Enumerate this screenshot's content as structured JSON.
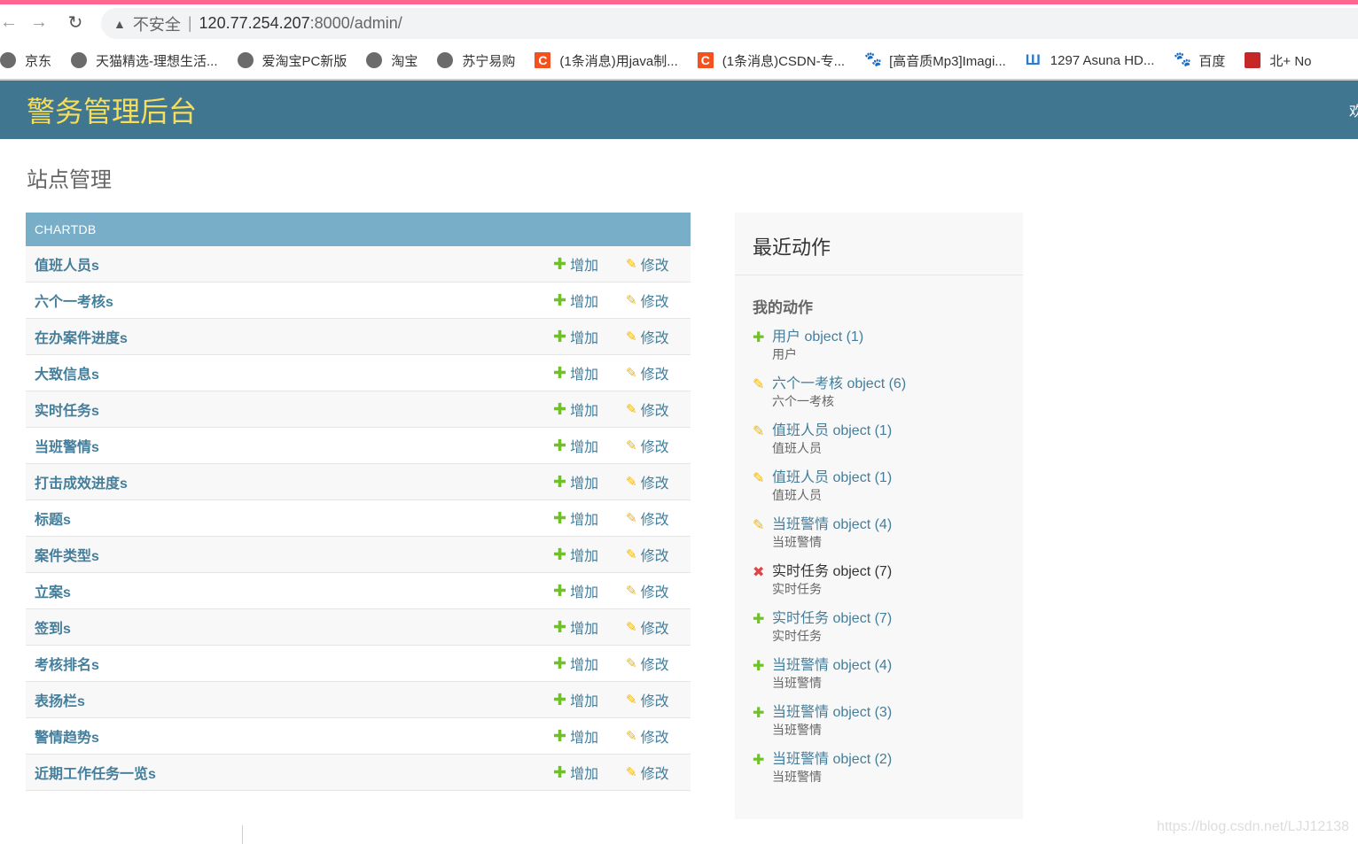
{
  "browser": {
    "url_host": "120.77.254.207",
    "url_rest": ":8000/admin/",
    "insecure_label": "不安全",
    "bookmarks": [
      {
        "label": "京东",
        "icon": "globe"
      },
      {
        "label": "天猫精选-理想生活...",
        "icon": "globe"
      },
      {
        "label": "爱淘宝PC新版",
        "icon": "globe"
      },
      {
        "label": "淘宝",
        "icon": "globe"
      },
      {
        "label": "苏宁易购",
        "icon": "globe"
      },
      {
        "label": "(1条消息)用java制...",
        "icon": "csdn"
      },
      {
        "label": "(1条消息)CSDN-专...",
        "icon": "csdn"
      },
      {
        "label": "[高音质Mp3]Imagi...",
        "icon": "baidu"
      },
      {
        "label": "1297 Asuna HD...",
        "icon": "u"
      },
      {
        "label": "百度",
        "icon": "baidu"
      },
      {
        "label": "北+ No",
        "icon": "seal"
      }
    ]
  },
  "header": {
    "title": "警务管理后台",
    "welcome": "欢"
  },
  "page_title": "站点管理",
  "module": {
    "caption": "CHARTDB",
    "add_label": "增加",
    "change_label": "修改",
    "models": [
      "值班人员s",
      "六个一考核s",
      "在办案件进度s",
      "大致信息s",
      "实时任务s",
      "当班警情s",
      "打击成效进度s",
      "标题s",
      "案件类型s",
      "立案s",
      "签到s",
      "考核排名s",
      "表扬栏s",
      "警情趋势s",
      "近期工作任务一览s"
    ]
  },
  "recent": {
    "title": "最近动作",
    "subtitle": "我的动作",
    "actions": [
      {
        "kind": "add",
        "label": "用户 object (1)",
        "type": "用户"
      },
      {
        "kind": "change",
        "label": "六个一考核 object (6)",
        "type": "六个一考核"
      },
      {
        "kind": "change",
        "label": "值班人员 object (1)",
        "type": "值班人员"
      },
      {
        "kind": "change",
        "label": "值班人员 object (1)",
        "type": "值班人员"
      },
      {
        "kind": "change",
        "label": "当班警情 object (4)",
        "type": "当班警情"
      },
      {
        "kind": "delete",
        "label": "实时任务 object (7)",
        "type": "实时任务"
      },
      {
        "kind": "add",
        "label": "实时任务 object (7)",
        "type": "实时任务"
      },
      {
        "kind": "add",
        "label": "当班警情 object (4)",
        "type": "当班警情"
      },
      {
        "kind": "add",
        "label": "当班警情 object (3)",
        "type": "当班警情"
      },
      {
        "kind": "add",
        "label": "当班警情 object (2)",
        "type": "当班警情"
      }
    ]
  },
  "watermark": "https://blog.csdn.net/LJJ12138",
  "colors": {
    "header": "#417690",
    "title": "#f5dd5d",
    "caption": "#79aec8",
    "link": "#447e9b",
    "add": "#70bf2b",
    "change": "#efb80b",
    "delete": "#dd4646"
  }
}
